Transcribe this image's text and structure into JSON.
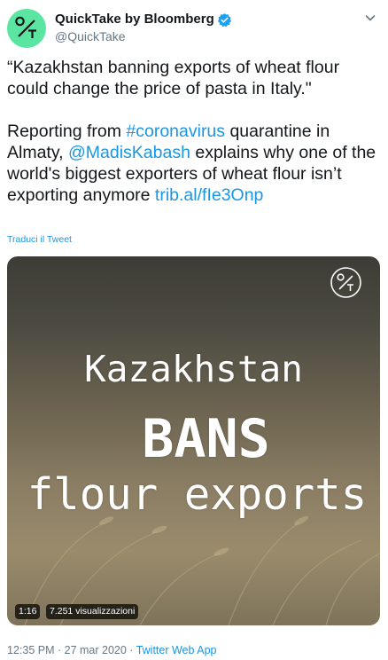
{
  "author": {
    "name": "QuickTake by Bloomberg",
    "handle": "@QuickTake",
    "verified": true,
    "avatar_icon": "quicktake-logo-icon",
    "avatar_color": "#5ae6a0"
  },
  "tweet": {
    "paragraph1": "“Kazakhstan banning exports of wheat flour could change the price of pasta in Italy.\"",
    "p2_text1": "Reporting from ",
    "p2_hashtag": "#coronavirus",
    "p2_text2": " quarantine in Almaty, ",
    "p2_mention": "@MadisKabash",
    "p2_text3": " explains why one of the world's biggest exporters of wheat flour isn’t exporting anymore ",
    "p2_link": "trib.al/fIe3Onp",
    "translate_label": "Traduci il Tweet"
  },
  "video": {
    "line1": "Kazakhstan",
    "line2": "BANS",
    "line3": "flour exports",
    "duration": "1:16",
    "views": "7.251 visualizzazioni",
    "badge_icon": "quicktake-badge-icon"
  },
  "footer": {
    "timestamp": "12:35 PM · 27 mar 2020 · ",
    "app": "Twitter Web App"
  },
  "colors": {
    "link": "#1b95e0",
    "muted": "#657786",
    "text": "#14171a"
  }
}
